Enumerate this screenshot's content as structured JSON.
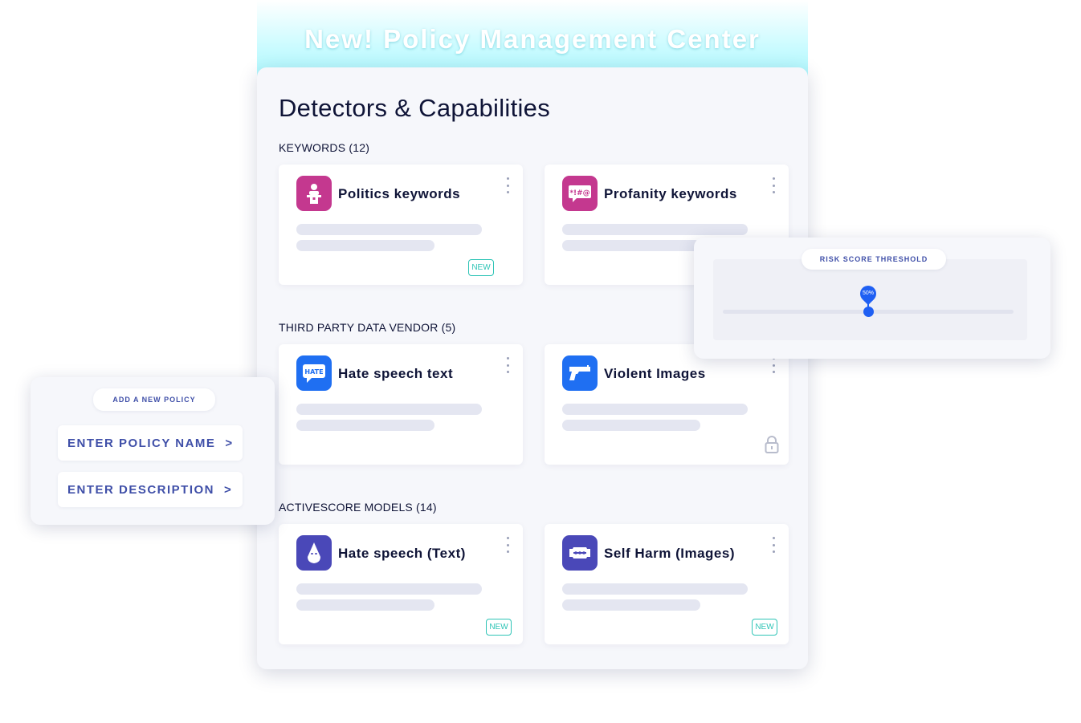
{
  "banner": {
    "title": "New! Policy Management Center"
  },
  "main": {
    "title": "Detectors & Capabilities",
    "sections": [
      {
        "label": "KEYWORDS (12)",
        "cards": [
          {
            "title": "Politics keywords",
            "icon": "podium-speaker-icon",
            "icon_color": "#c4388f",
            "badge": "NEW"
          },
          {
            "title": "Profanity keywords",
            "icon": "symbol-speech-icon",
            "icon_color": "#c4388f",
            "icon_text": "*!#@"
          }
        ]
      },
      {
        "label": "THIRD PARTY DATA VENDOR (5)",
        "cards": [
          {
            "title": "Hate speech text",
            "icon": "hate-chat-icon",
            "icon_color": "#1f6ff2",
            "icon_text": "HATE"
          },
          {
            "title": "Violent Images",
            "icon": "gun-icon",
            "icon_color": "#1f6ff2",
            "locked": true
          }
        ]
      },
      {
        "label": "ACTIVESCORE MODELS (14)",
        "cards": [
          {
            "title": "Hate speech (Text)",
            "icon": "hooded-figure-icon",
            "icon_color": "#4a48b8",
            "badge": "NEW"
          },
          {
            "title": "Self Harm (Images)",
            "icon": "razor-blade-icon",
            "icon_color": "#4a48b8",
            "badge": "NEW"
          }
        ]
      }
    ]
  },
  "risk": {
    "label": "RISK SCORE THRESHOLD",
    "value_label": "50%",
    "value": 0.5,
    "accent": "#1f5ff3"
  },
  "policy": {
    "label": "ADD A NEW POLICY",
    "name_label": "ENTER POLICY NAME",
    "desc_label": "ENTER DESCRIPTION",
    "chevron": ">"
  }
}
